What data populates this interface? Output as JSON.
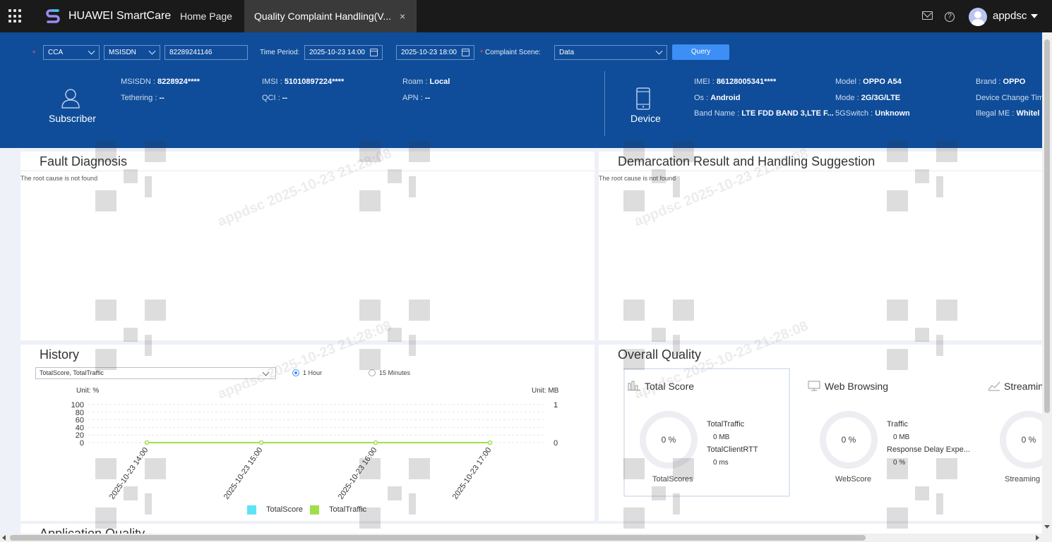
{
  "topbar": {
    "brand": "HUAWEI SmartCare",
    "tabs": [
      {
        "label": "Home Page"
      },
      {
        "label": "Quality Complaint Handling(V...",
        "close": "×"
      }
    ],
    "help": "?",
    "username": "appdsc"
  },
  "query": {
    "type_select": "CCA",
    "id_type_select": "MSISDN",
    "id_value": "82289241146",
    "time_period_label": "Time Period:",
    "start_time": "2025-10-23 14:00",
    "end_time": "2025-10-23 18:00",
    "complaint_scene_label": "Complaint Scene:",
    "complaint_scene": "Data",
    "query_button": "Query",
    "required_mark": "*"
  },
  "subscriber": {
    "title": "Subscriber",
    "fields": [
      {
        "key": "MSISDN",
        "value": "8228924****"
      },
      {
        "key": "IMSI",
        "value": "51010897224****"
      },
      {
        "key": "Roam",
        "value": "Local"
      },
      {
        "key": "Tethering",
        "value": "--"
      },
      {
        "key": "QCI",
        "value": "--"
      },
      {
        "key": "APN",
        "value": "--"
      }
    ]
  },
  "device": {
    "title": "Device",
    "fields": [
      {
        "key": "IMEI",
        "value": "86128005341****"
      },
      {
        "key": "Model",
        "value": "OPPO A54"
      },
      {
        "key": "Brand",
        "value": "OPPO"
      },
      {
        "key": "Os",
        "value": "Android"
      },
      {
        "key": "Mode",
        "value": "2G/3G/LTE"
      },
      {
        "key": "Device Change Tim",
        "value": ""
      },
      {
        "key": "Band Name",
        "value": "LTE FDD BAND 3,LTE F..."
      },
      {
        "key": "5GSwitch",
        "value": "Unknown"
      },
      {
        "key": "Illegal ME",
        "value": "Whitel"
      }
    ]
  },
  "separator": ":",
  "fault_diagnosis": {
    "title": "Fault Diagnosis",
    "message": "The root cause is not found"
  },
  "demarcation": {
    "title": "Demarcation Result and Handling Suggestion",
    "message": "The root cause is not found"
  },
  "history": {
    "title": "History",
    "metric_select": "TotalScore, TotalTraffic",
    "granularity_options": [
      {
        "label": "1 Hour",
        "selected": true
      },
      {
        "label": "15 Minutes",
        "selected": false
      }
    ],
    "left_unit": "Unit: %",
    "right_unit": "Unit: MB",
    "legend": [
      {
        "label": "TotalScore",
        "color": "#5de3f5"
      },
      {
        "label": "TotalTraffic",
        "color": "#9ee04a"
      }
    ]
  },
  "chart_data": {
    "type": "line",
    "x": [
      "2025-10-23 14:00",
      "2025-10-23 15:00",
      "2025-10-23 16:00",
      "2025-10-23 17:00"
    ],
    "left_ticks": [
      "100",
      "80",
      "60",
      "40",
      "20",
      "0"
    ],
    "right_ticks": [
      "1",
      "0"
    ],
    "ylim_left": [
      0,
      100
    ],
    "ylim_right": [
      0,
      1
    ],
    "series": [
      {
        "name": "TotalScore",
        "axis": "left",
        "values": [
          null,
          null,
          null,
          null
        ]
      },
      {
        "name": "TotalTraffic",
        "axis": "right",
        "values": [
          0,
          0,
          0,
          0
        ]
      }
    ]
  },
  "overall_quality": {
    "title": "Overall Quality",
    "cards": [
      {
        "title": "Total Score",
        "icon": "bar-chart-icon",
        "donut_value": "0 %",
        "caption": "TotalScores",
        "metrics": [
          {
            "label": "TotalTraffic",
            "value": "0 MB"
          },
          {
            "label": "TotalClientRTT",
            "value": "0 ms"
          }
        ]
      },
      {
        "title": "Web Browsing",
        "icon": "monitor-icon",
        "donut_value": "0 %",
        "caption": "WebScore",
        "metrics": [
          {
            "label": "Traffic",
            "value": "0 MB"
          },
          {
            "label": "Response Delay Expe...",
            "value": "0 %"
          }
        ]
      },
      {
        "title": "Streamin",
        "icon": "line-chart-icon",
        "donut_value": "0 %",
        "caption": "Streaming",
        "metrics": []
      }
    ]
  },
  "next_section_title": "Application Quality",
  "watermark": "appdsc 2025-10-23 21:28:08",
  "colors": {
    "header_blue": "#0f4d9a",
    "query_blue": "#3d8ef5",
    "topbar": "#1a1a1a"
  }
}
